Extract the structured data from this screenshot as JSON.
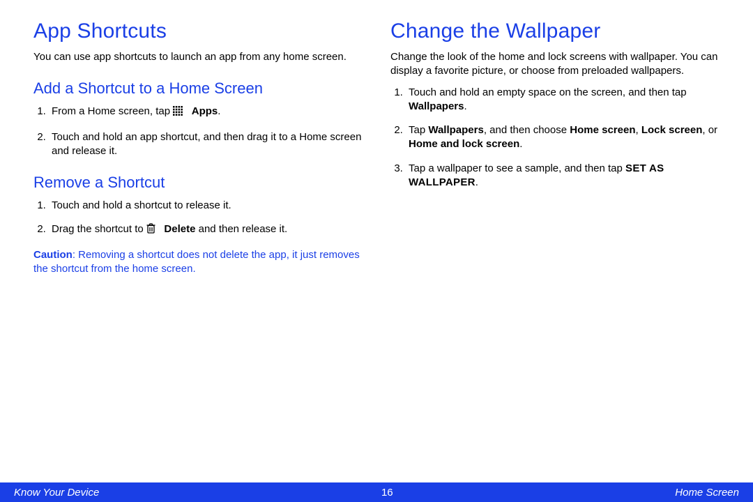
{
  "left": {
    "h1": "App Shortcuts",
    "intro": "You can use app shortcuts to launch an app from any home screen.",
    "addH2": "Add a Shortcut to a Home Screen",
    "add1_a": "From a Home screen, tap ",
    "add1_b": "Apps",
    "add1_c": ".",
    "add2": "Touch and hold an app shortcut, and then drag it to a Home screen and release it.",
    "removeH2": "Remove a Shortcut",
    "rem1": "Touch and hold a shortcut to release it.",
    "rem2_a": "Drag the shortcut to ",
    "rem2_b": "Delete",
    "rem2_c": " and then release it.",
    "caution_label": "Caution",
    "caution_text": ": Removing a shortcut does not delete the app, it just removes the shortcut from the home screen."
  },
  "right": {
    "h1": "Change the Wallpaper",
    "intro": "Change the look of the home and lock screens with wallpaper. You can display a favorite picture, or choose from preloaded wallpapers.",
    "w1_a": "Touch and hold an empty space on the screen, and then tap ",
    "w1_b": "Wallpapers",
    "w1_c": ".",
    "w2_a": "Tap ",
    "w2_b": "Wallpapers",
    "w2_c": ", and then choose ",
    "w2_d": "Home screen",
    "w2_e": ", ",
    "w2_f": "Lock screen",
    "w2_g": ", or ",
    "w2_h": "Home and lock screen",
    "w2_i": ".",
    "w3_a": "Tap a wallpaper to see a sample, and then tap ",
    "w3_b": "Set As Wallpaper",
    "w3_c": "."
  },
  "footer": {
    "left": "Know Your Device",
    "page": "16",
    "right": "Home Screen"
  }
}
